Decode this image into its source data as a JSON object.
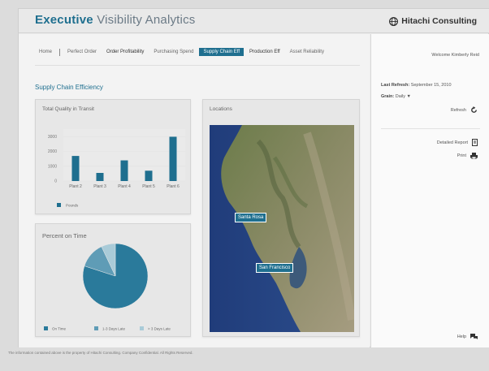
{
  "header": {
    "title_bold": "Executive",
    "title_rest": "Visibility Analytics",
    "brand": "Hitachi Consulting"
  },
  "nav": {
    "items": [
      "Home",
      "Perfect Order",
      "Order Profitability",
      "Purchasing Spend",
      "Supply Chain Eff",
      "Production Eff",
      "Asset Reliability"
    ]
  },
  "section_title": "Supply Chain Efficiency",
  "quality_chart": {
    "title": "Total Quality in Transit",
    "chart_data": {
      "type": "bar",
      "categories": [
        "Plant 2",
        "Plant 3",
        "Plant 4",
        "Plant 5",
        "Plant 6"
      ],
      "series": [
        {
          "name": "Pounds",
          "values": [
            1700,
            550,
            1400,
            700,
            3000
          ]
        }
      ],
      "yticks": [
        0,
        1000,
        2000,
        3000
      ],
      "ylim": [
        0,
        3300
      ],
      "color": "#1f6f8f"
    }
  },
  "percent_chart": {
    "title": "Percent on Time",
    "chart_data": {
      "type": "pie",
      "labels": [
        "On Time",
        "1-3 Days Late",
        "> 3 Days Late"
      ],
      "values": [
        80,
        13,
        7
      ],
      "colors": [
        "#2a7a9b",
        "#5f9cb6",
        "#a9cbd8"
      ]
    }
  },
  "locations": {
    "title": "Locations",
    "markers": [
      "Santa Rosa",
      "San Francisco"
    ]
  },
  "side": {
    "welcome": "Welcome Kimberly Reid",
    "last_refresh_label": "Last Refresh:",
    "last_refresh_value": "September 15, 2010",
    "grain_label": "Grain:",
    "grain_value": "Daily",
    "refresh": "Refresh",
    "detailed_report": "Detailed Report",
    "print": "Print",
    "help": "Help"
  },
  "footer": "The information contained above is the property of Hitachi Consulting. Company Confidential. All Rights Reserved."
}
